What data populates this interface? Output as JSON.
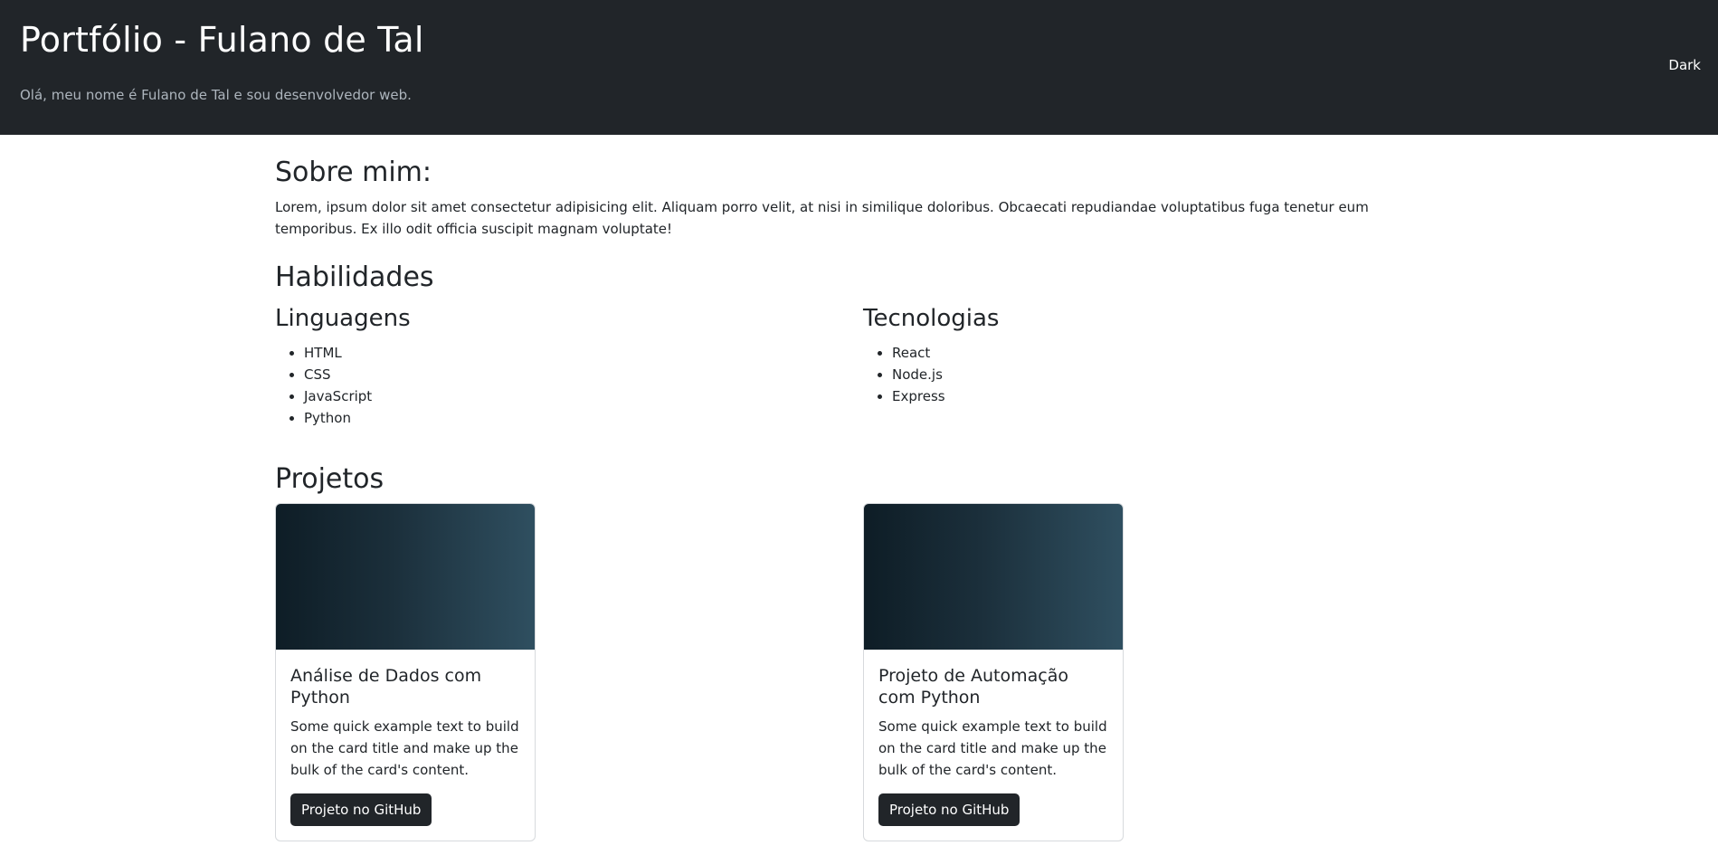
{
  "header": {
    "title": "Portfólio - Fulano de Tal",
    "subtitle": "Olá, meu nome é Fulano de Tal e sou desenvolvedor web.",
    "theme_toggle_label": "Dark"
  },
  "about": {
    "heading": "Sobre mim:",
    "text": "Lorem, ipsum dolor sit amet consectetur adipisicing elit. Aliquam porro velit, at nisi in similique doloribus. Obcaecati repudiandae voluptatibus fuga tenetur eum temporibus. Ex illo odit officia suscipit magnam voluptate!"
  },
  "skills": {
    "heading": "Habilidades",
    "languages": {
      "heading": "Linguagens",
      "items": [
        "HTML",
        "CSS",
        "JavaScript",
        "Python"
      ]
    },
    "technologies": {
      "heading": "Tecnologias",
      "items": [
        "React",
        "Node.js",
        "Express"
      ]
    }
  },
  "projects": {
    "heading": "Projetos",
    "cards": [
      {
        "title": "Análise de Dados com Python",
        "text": "Some quick example text to build on the card title and make up the bulk of the card's content.",
        "button_label": "Projeto no GitHub"
      },
      {
        "title": "Projeto de Automação com Python",
        "text": "Some quick example text to build on the card title and make up the bulk of the card's content.",
        "button_label": "Projeto no GitHub"
      }
    ]
  },
  "colors": {
    "header_bg": "#212529",
    "button_bg": "#212529",
    "card_image_gradient_start": "#0e1d26",
    "card_image_gradient_end": "#2f4f60"
  }
}
